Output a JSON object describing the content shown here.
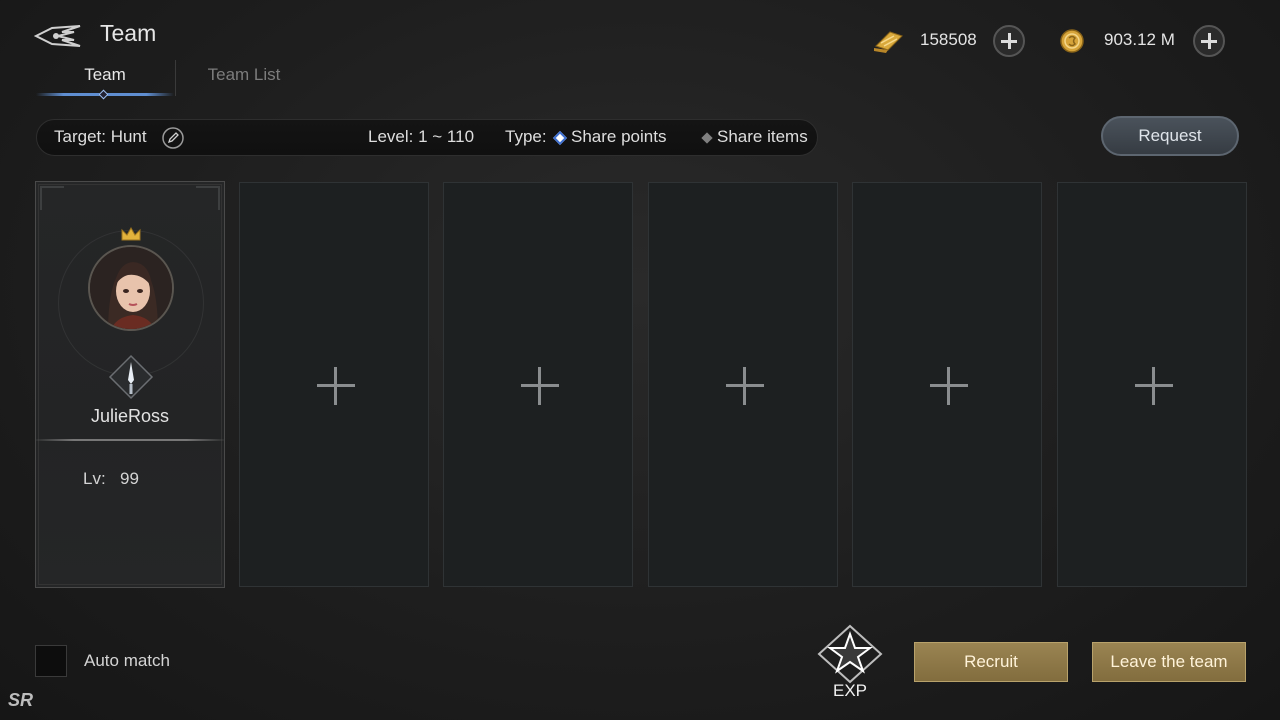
{
  "header": {
    "title": "Team",
    "back_icon": "winged-back-icon",
    "tabs": [
      {
        "label": "Team",
        "active": true
      },
      {
        "label": "Team List",
        "active": false
      }
    ]
  },
  "currencies": [
    {
      "icon": "gold-scroll-icon",
      "value": "158508"
    },
    {
      "icon": "gold-coin-icon",
      "value": "903.12 M"
    }
  ],
  "info_bar": {
    "target": "Target: Hunt",
    "level": "Level: 1 ~ 110",
    "type_label": "Type:",
    "share_points": "Share points",
    "share_items": "Share items",
    "selected_type": "Share points"
  },
  "request_label": "Request",
  "member": {
    "name": "JulieRoss",
    "lv_label": "Lv:",
    "lv_value": "99",
    "is_leader": true,
    "class_icon": "dagger-class-icon"
  },
  "empty_slots": 5,
  "footer": {
    "auto_match": "Auto match",
    "exp": "EXP",
    "recruit": "Recruit",
    "leave": "Leave the team",
    "logo": "SR"
  },
  "colors": {
    "accent_blue": "#5f8ed1",
    "gold_button": "#9a8452",
    "request_button": "#4a525b"
  }
}
